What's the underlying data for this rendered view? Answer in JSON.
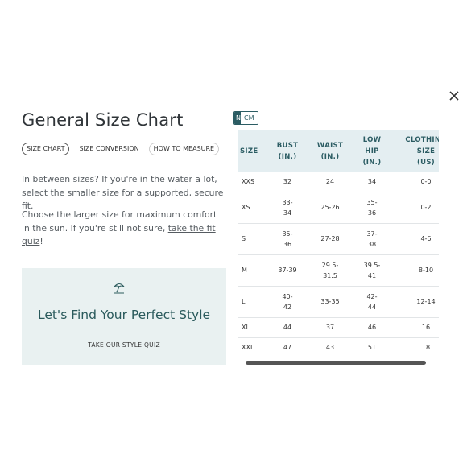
{
  "title": "General Size Chart",
  "tabs": [
    {
      "label": "SIZE CHART",
      "active": true
    },
    {
      "label": "SIZE CONVERSION",
      "active": false
    },
    {
      "label": "HOW TO MEASURE",
      "active": false
    }
  ],
  "paragraph1": "In between sizes? If you're in the water a lot, select the smaller size for a supported, secure fit.",
  "paragraph2_prefix": "Choose the larger size for maximum comfort in the sun. If you're still not sure, ",
  "paragraph2_link": "take the fit quiz",
  "paragraph2_suffix": "!",
  "promo": {
    "icon": "beach-umbrella-icon",
    "headline": "Let's Find Your Perfect Style",
    "cta": "TAKE OUR STYLE QUIZ",
    "bg_color": "#e9f1f1",
    "text_color": "#2a5a5c"
  },
  "units": {
    "selected": "N",
    "other": "CM"
  },
  "table": {
    "headers": [
      [
        "SIZE"
      ],
      [
        "BUST",
        "(IN.)"
      ],
      [
        "WAIST",
        "(IN.)"
      ],
      [
        "LOW",
        "HIP",
        "(IN.)"
      ],
      [
        "CLOTHING",
        "SIZE",
        "(US)"
      ]
    ],
    "rows": [
      {
        "size": "XXS",
        "bust": [
          "32"
        ],
        "waist": [
          "24"
        ],
        "hip": [
          "34"
        ],
        "clothing": "0-0"
      },
      {
        "size": "XS",
        "bust": [
          "33-",
          "34"
        ],
        "waist": [
          "25-26"
        ],
        "hip": [
          "35-",
          "36"
        ],
        "clothing": "0-2"
      },
      {
        "size": "S",
        "bust": [
          "35-",
          "36"
        ],
        "waist": [
          "27-28"
        ],
        "hip": [
          "37-",
          "38"
        ],
        "clothing": "4-6"
      },
      {
        "size": "M",
        "bust": [
          "37-39"
        ],
        "waist": [
          "29.5-",
          "31.5"
        ],
        "hip": [
          "39.5-",
          "41"
        ],
        "clothing": "8-10"
      },
      {
        "size": "L",
        "bust": [
          "40-",
          "42"
        ],
        "waist": [
          "33-35"
        ],
        "hip": [
          "42-",
          "44"
        ],
        "clothing": "12-14"
      },
      {
        "size": "XL",
        "bust": [
          "44"
        ],
        "waist": [
          "37"
        ],
        "hip": [
          "46"
        ],
        "clothing": "16"
      },
      {
        "size": "XXL",
        "bust": [
          "47"
        ],
        "waist": [
          "43"
        ],
        "hip": [
          "51"
        ],
        "clothing": "18"
      }
    ],
    "header_color": "#2b5c63",
    "header_bg": "#e4eef1"
  },
  "close_icon": "close-icon"
}
